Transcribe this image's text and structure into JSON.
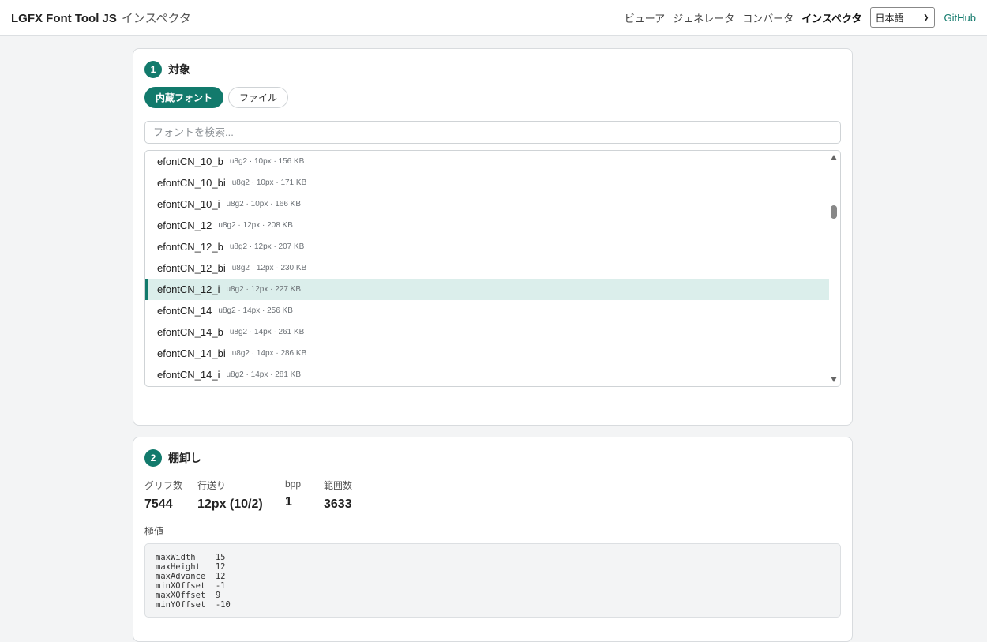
{
  "header": {
    "brand": "LGFX Font Tool JS",
    "subtitle": "インスペクタ",
    "nav": [
      "ビューア",
      "ジェネレータ",
      "コンバータ",
      "インスペクタ"
    ],
    "active_nav": "インスペクタ",
    "language": "日本語",
    "github": "GitHub"
  },
  "target": {
    "step": "1",
    "title": "対象",
    "tabs": [
      "内蔵フォント",
      "ファイル"
    ],
    "active_tab": "内蔵フォント",
    "search_placeholder": "フォントを検索...",
    "fonts": [
      {
        "name": "efontCN_10_b",
        "meta": "u8g2 · 10px · 156 KB"
      },
      {
        "name": "efontCN_10_bi",
        "meta": "u8g2 · 10px · 171 KB"
      },
      {
        "name": "efontCN_10_i",
        "meta": "u8g2 · 10px · 166 KB"
      },
      {
        "name": "efontCN_12",
        "meta": "u8g2 · 12px · 208 KB"
      },
      {
        "name": "efontCN_12_b",
        "meta": "u8g2 · 12px · 207 KB"
      },
      {
        "name": "efontCN_12_bi",
        "meta": "u8g2 · 12px · 230 KB"
      },
      {
        "name": "efontCN_12_i",
        "meta": "u8g2 · 12px · 227 KB"
      },
      {
        "name": "efontCN_14",
        "meta": "u8g2 · 14px · 256 KB"
      },
      {
        "name": "efontCN_14_b",
        "meta": "u8g2 · 14px · 261 KB"
      },
      {
        "name": "efontCN_14_bi",
        "meta": "u8g2 · 14px · 286 KB"
      },
      {
        "name": "efontCN_14_i",
        "meta": "u8g2 · 14px · 281 KB"
      }
    ],
    "selected_font": "efontCN_12_i"
  },
  "inventory": {
    "step": "2",
    "title": "棚卸し",
    "stats": [
      {
        "label": "グリフ数",
        "value": "7544"
      },
      {
        "label": "行送り",
        "value": "12px (10/2)"
      },
      {
        "label": "bpp",
        "value": "1"
      },
      {
        "label": "範囲数",
        "value": "3633"
      }
    ],
    "extremes_label": "極値",
    "extremes": [
      {
        "key": "maxWidth",
        "value": "15"
      },
      {
        "key": "maxHeight",
        "value": "12"
      },
      {
        "key": "maxAdvance",
        "value": "12"
      },
      {
        "key": "minXOffset",
        "value": "-1"
      },
      {
        "key": "maxXOffset",
        "value": "9"
      },
      {
        "key": "minYOffset",
        "value": "-10"
      }
    ]
  },
  "colors": {
    "accent": "#127a6c",
    "selected_row": "#dbeeeb"
  }
}
